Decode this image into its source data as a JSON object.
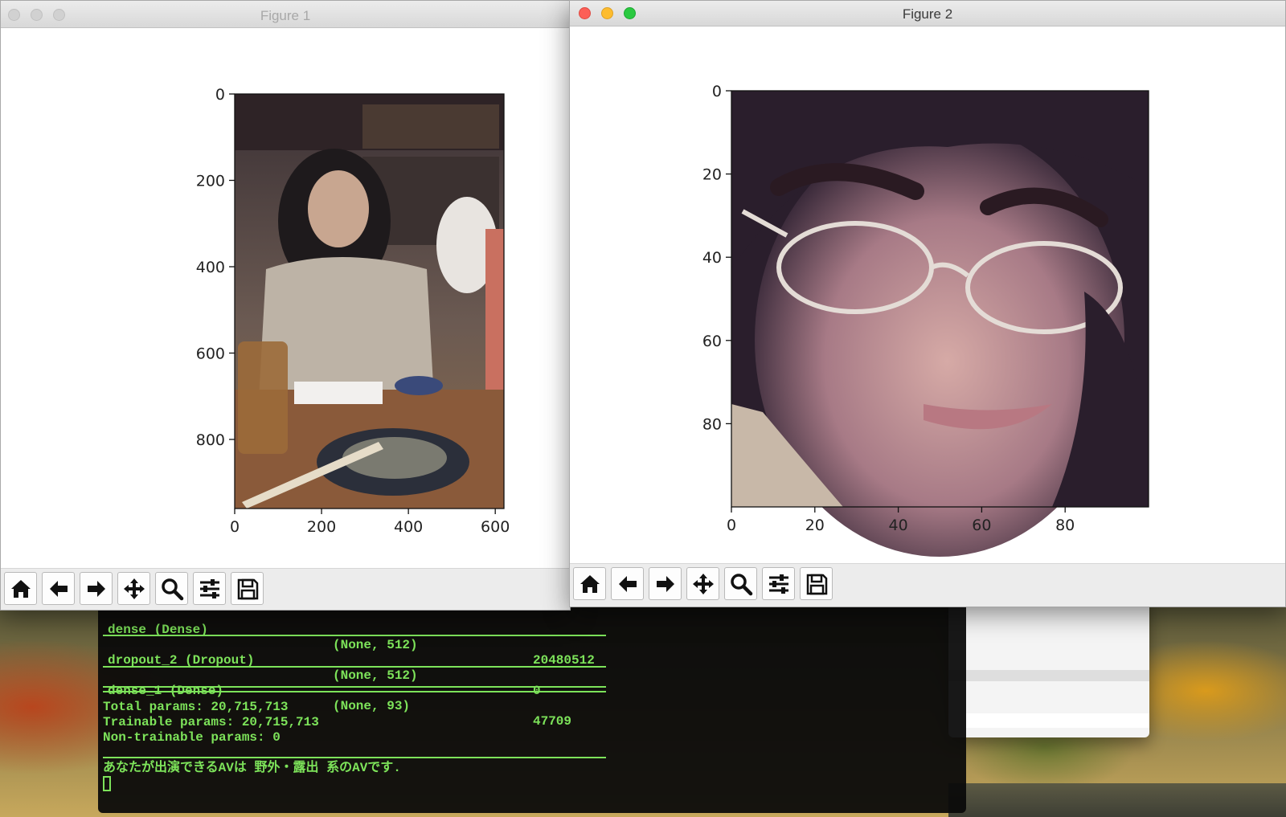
{
  "figure1": {
    "title": "Figure 1",
    "chart_data": {
      "type": "image",
      "xticks": [
        "0",
        "200",
        "400",
        "600"
      ],
      "yticks": [
        "0",
        "200",
        "400",
        "600",
        "800"
      ],
      "xlim": [
        0,
        620
      ],
      "ylim": [
        960,
        0
      ]
    }
  },
  "figure2": {
    "title": "Figure 2",
    "chart_data": {
      "type": "image",
      "xticks": [
        "0",
        "20",
        "40",
        "60",
        "80"
      ],
      "yticks": [
        "0",
        "20",
        "40",
        "60",
        "80"
      ],
      "xlim": [
        0,
        100
      ],
      "ylim": [
        100,
        0
      ]
    }
  },
  "toolbar": {
    "buttons": [
      "home-icon",
      "back-arrow-icon",
      "forward-arrow-icon",
      "pan-icon",
      "zoom-icon",
      "configure-subplots-icon",
      "save-icon"
    ]
  },
  "terminal": {
    "rows": [
      {
        "layer": "dense (Dense)",
        "shape": "(None, 512)",
        "params": "20480512"
      },
      {
        "layer": "dropout_2 (Dropout)",
        "shape": "(None, 512)",
        "params": "0"
      },
      {
        "layer": "dense_1 (Dense)",
        "shape": "(None, 93)",
        "params": "47709"
      }
    ],
    "total_params": "Total params: 20,715,713",
    "trainable_params": "Trainable params: 20,715,713",
    "non_trainable_params": "Non-trainable params: 0",
    "result": "あなたが出演できるAVは 野外・露出 系のAVです."
  }
}
